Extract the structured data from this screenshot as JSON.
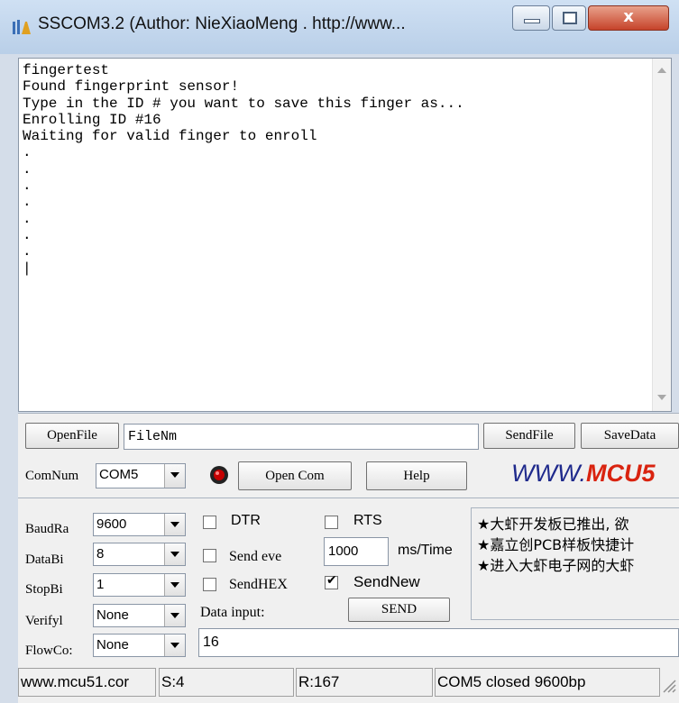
{
  "window": {
    "title": "SSCOM3.2 (Author: NieXiaoMeng . http://www...",
    "close_label": "x"
  },
  "output": {
    "text": "fingertest\nFound fingerprint sensor!\nType in the ID # you want to save this finger as...\nEnrolling ID #16\nWaiting for valid finger to enroll\n.\n.\n.\n.\n.\n.\n.\n|"
  },
  "file_row": {
    "open_file": "OpenFile",
    "filename": "FileNm",
    "send_file": "SendFile",
    "save_data": "SaveData"
  },
  "com_row": {
    "comnum_label": "ComNum",
    "com_port": "COM5",
    "open_com": "Open Com",
    "help": "Help",
    "brand": "WWW.",
    "brand_red": "MCU5"
  },
  "settings": {
    "baud_label": "BaudRa",
    "baud": "9600",
    "databits_label": "DataBi",
    "databits": "8",
    "stopbits_label": "StopBi",
    "stopbits": "1",
    "verify_label": "Verifyl",
    "verify": "None",
    "flow_label": "FlowCo:",
    "flow": "None"
  },
  "options": {
    "dtr": "DTR",
    "rts": "RTS",
    "send_every": "Send eve",
    "interval": "1000",
    "interval_unit": "ms/Time",
    "send_hex": "SendHEX",
    "send_new": "SendNew",
    "data_input_label": "Data input:",
    "send_button": "SEND",
    "data_input": "16"
  },
  "ads": {
    "line1": "★大虾开发板已推出, 欲",
    "line2": "★嘉立创PCB样板快捷计",
    "line3": "★进入大虾电子网的大虾"
  },
  "status": {
    "site": "www.mcu51.cor",
    "s_count": "S:4",
    "r_count": "R:167",
    "port_state": "COM5 closed  9600bp"
  },
  "colors": {
    "brand_blue": "#1f2a8c",
    "brand_red": "#d9230f",
    "record_red": "#c40000"
  }
}
